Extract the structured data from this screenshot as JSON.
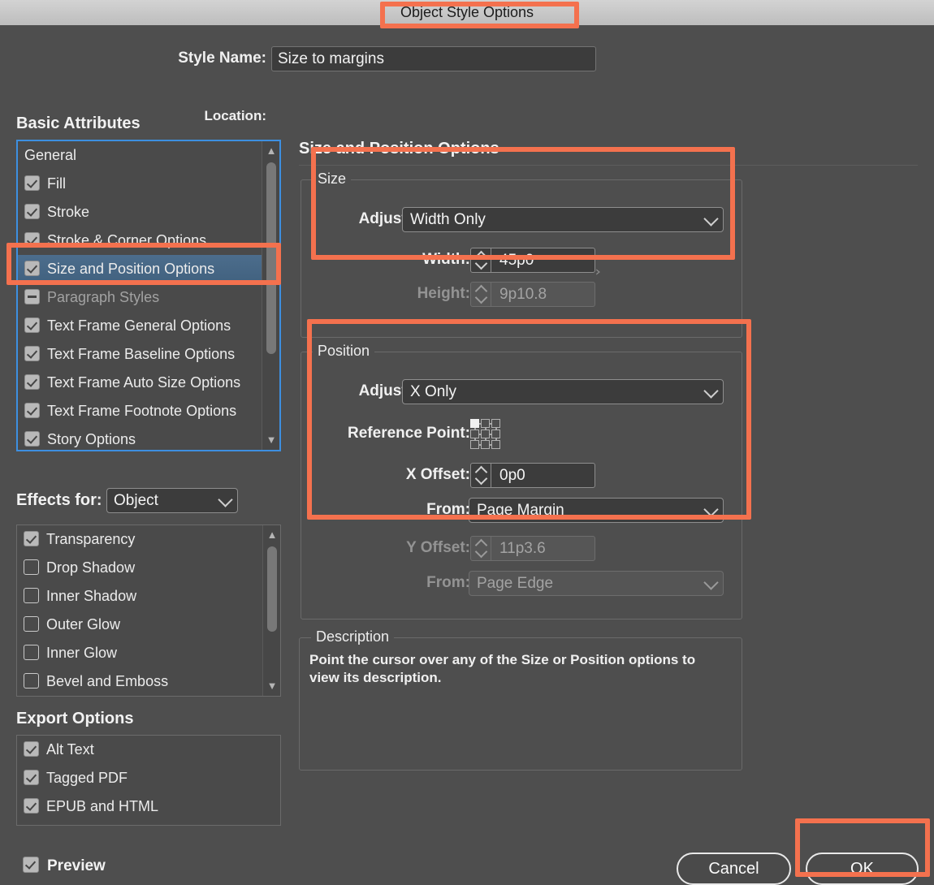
{
  "window": {
    "title": "Object Style Options"
  },
  "header": {
    "style_name_label": "Style Name:",
    "style_name_value": "Size to margins",
    "location_label": "Location:",
    "location_value": ""
  },
  "left_panel": {
    "basic_attributes_heading": "Basic Attributes",
    "basic_attributes": [
      {
        "label": "General",
        "checkbox": "none",
        "state": "plain"
      },
      {
        "label": "Fill",
        "checkbox": "checked",
        "state": "normal"
      },
      {
        "label": "Stroke",
        "checkbox": "checked",
        "state": "normal"
      },
      {
        "label": "Stroke & Corner Options",
        "checkbox": "checked",
        "state": "normal"
      },
      {
        "label": "Size and Position Options",
        "checkbox": "checked",
        "state": "selected"
      },
      {
        "label": "Paragraph Styles",
        "checkbox": "mixed",
        "state": "dim"
      },
      {
        "label": "Text Frame General Options",
        "checkbox": "checked",
        "state": "normal"
      },
      {
        "label": "Text Frame Baseline Options",
        "checkbox": "checked",
        "state": "normal"
      },
      {
        "label": "Text Frame Auto Size Options",
        "checkbox": "checked",
        "state": "normal"
      },
      {
        "label": "Text Frame Footnote Options",
        "checkbox": "checked",
        "state": "normal"
      },
      {
        "label": "Story Options",
        "checkbox": "checked",
        "state": "normal"
      }
    ],
    "effects_for_label": "Effects for:",
    "effects_for_value": "Object",
    "effects": [
      {
        "label": "Transparency",
        "checkbox": "checked"
      },
      {
        "label": "Drop Shadow",
        "checkbox": "unchecked"
      },
      {
        "label": "Inner Shadow",
        "checkbox": "unchecked"
      },
      {
        "label": "Outer Glow",
        "checkbox": "unchecked"
      },
      {
        "label": "Inner Glow",
        "checkbox": "unchecked"
      },
      {
        "label": "Bevel and Emboss",
        "checkbox": "unchecked"
      }
    ],
    "export_options_heading": "Export Options",
    "export_options": [
      {
        "label": "Alt Text",
        "checkbox": "checked"
      },
      {
        "label": "Tagged PDF",
        "checkbox": "checked"
      },
      {
        "label": "EPUB and HTML",
        "checkbox": "checked"
      }
    ]
  },
  "right_panel": {
    "heading": "Size and Position Options",
    "size_group": {
      "title": "Size",
      "adjust_label": "Adjust:",
      "adjust_value": "Width Only",
      "width_label": "Width:",
      "width_value": "45p0",
      "height_label": "Height:",
      "height_value": "9p10.8"
    },
    "position_group": {
      "title": "Position",
      "adjust_label": "Adjust:",
      "adjust_value": "X Only",
      "reference_point_label": "Reference Point:",
      "reference_point_selected": "top-left",
      "x_offset_label": "X Offset:",
      "x_offset_value": "0p0",
      "x_from_label": "From:",
      "x_from_value": "Page Margin",
      "y_offset_label": "Y Offset:",
      "y_offset_value": "11p3.6",
      "y_from_label": "From:",
      "y_from_value": "Page Edge"
    },
    "description_group": {
      "title": "Description",
      "text": "Point the cursor over any of the Size or Position options to view its description."
    }
  },
  "footer": {
    "preview_label": "Preview",
    "preview_checked": true,
    "cancel_label": "Cancel",
    "ok_label": "OK"
  },
  "annotations": {
    "highlight_color": "#f4714e",
    "boxes": [
      "window-title",
      "size-and-position-options-row",
      "size-group",
      "position-group",
      "ok-button"
    ]
  }
}
